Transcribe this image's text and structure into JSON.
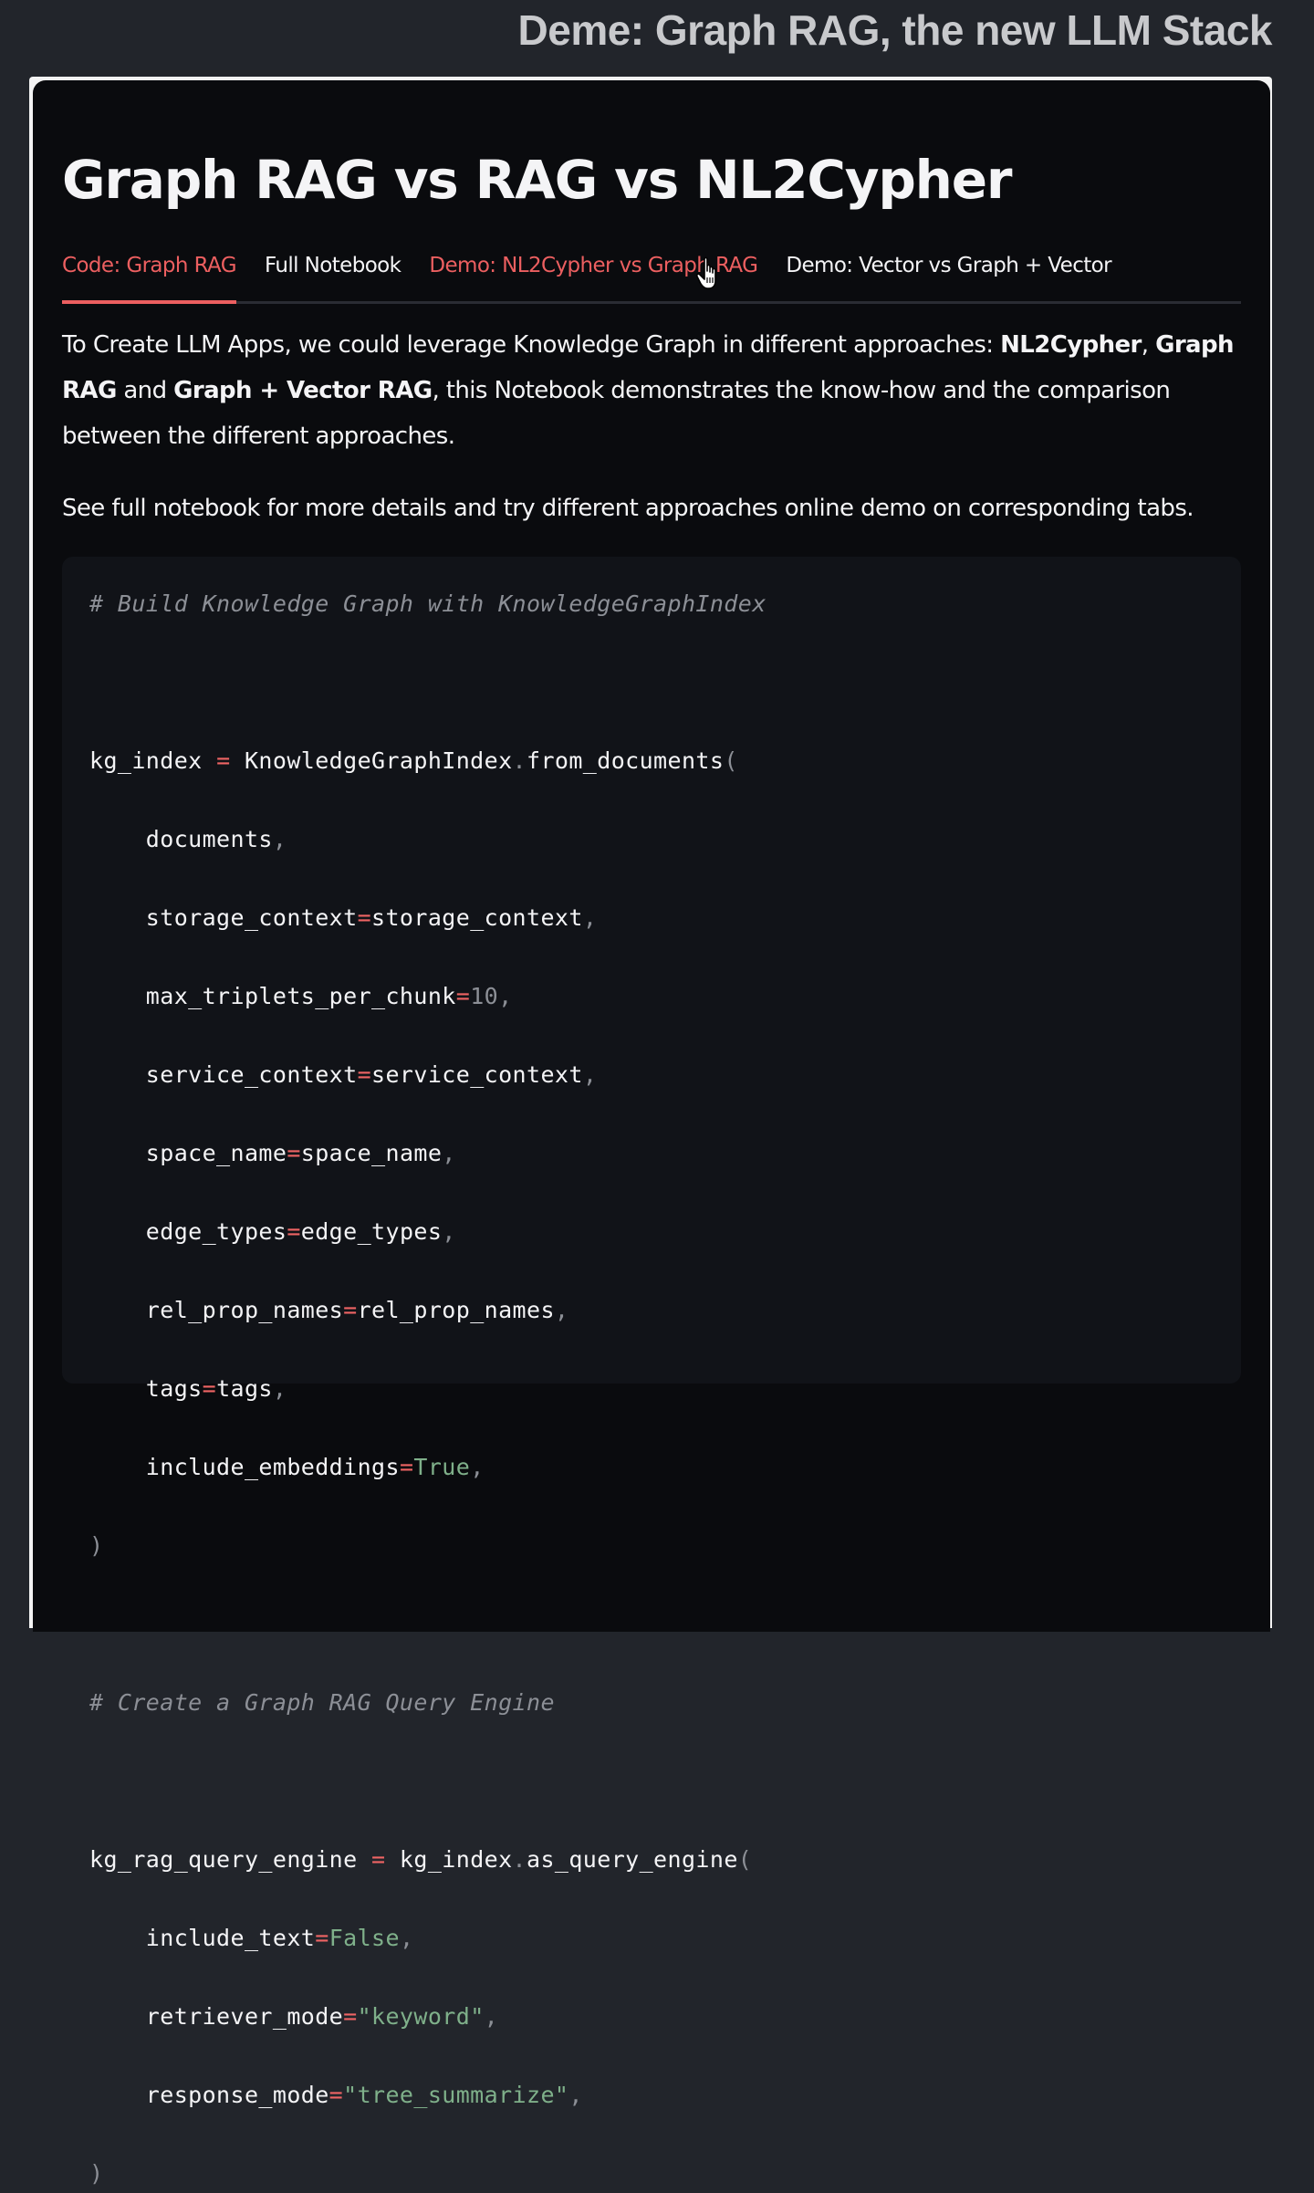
{
  "header": {
    "title": "Deme: Graph RAG, the new LLM Stack"
  },
  "page": {
    "title": "Graph RAG vs RAG vs NL2Cypher"
  },
  "tabs": [
    {
      "label": "Code: Graph RAG",
      "active": true
    },
    {
      "label": "Full Notebook",
      "active": false
    },
    {
      "label": "Demo: NL2Cypher vs Graph RAG",
      "active": false
    },
    {
      "label": "Demo: Vector vs Graph + Vector",
      "active": false
    }
  ],
  "intro": {
    "p1_before": "To Create LLM Apps, we could leverage Knowledge Graph in different approaches: ",
    "p1_b1": "NL2Cypher",
    "p1_sep1": ", ",
    "p1_b2": "Graph RAG",
    "p1_sep2": " and ",
    "p1_b3": "Graph + Vector RAG",
    "p1_after": ", this Notebook demonstrates the know-how and the comparison between the different approaches.",
    "p2": "See full notebook for more details and try different approaches online demo on corresponding tabs."
  },
  "code": {
    "comment1": "# Build Knowledge Graph with KnowledgeGraphIndex",
    "comment2": "# Create a Graph RAG Query Engine"
  },
  "colors": {
    "accent": "#ec5f60",
    "background": "#0a0b0e",
    "code_background": "#111318"
  }
}
